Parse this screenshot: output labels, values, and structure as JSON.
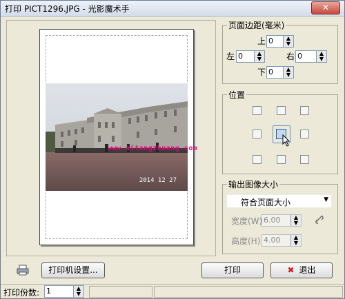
{
  "window": {
    "title": "打印 PICT1296.JPG - 光影魔术手",
    "close_glyph": "✕"
  },
  "preview": {
    "date_stamp": "2014 12 27",
    "watermark": "www.aitangzhuang.com"
  },
  "margins": {
    "legend": "页面边距(毫米)",
    "top_label": "上",
    "top_value": "0",
    "left_label": "左",
    "left_value": "0",
    "right_label": "右",
    "right_value": "0",
    "bottom_label": "下",
    "bottom_value": "0"
  },
  "position": {
    "legend": "位置",
    "selected": "center"
  },
  "output_size": {
    "legend": "输出图像大小",
    "mode_value": "符合页面大小",
    "width_label": "宽度(W)",
    "width_value": "6.00",
    "height_label": "高度(H)",
    "height_value": "4.00",
    "link_icon": "chain-link-icon"
  },
  "buttons": {
    "printer_settings": "打印机设置...",
    "print": "打印",
    "exit": "退出"
  },
  "status": {
    "copies_label": "打印份数:",
    "copies_value": "1"
  },
  "colors": {
    "accent": "#5a92d8",
    "watermark": "#e6007e",
    "exit_icon": "#d22020"
  }
}
